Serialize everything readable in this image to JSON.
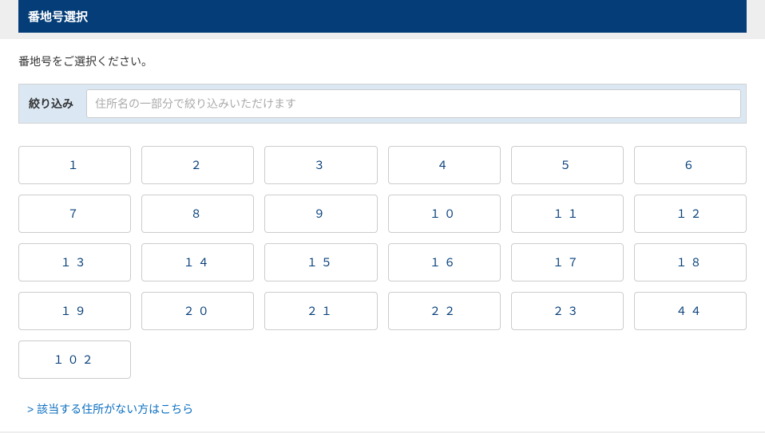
{
  "header": {
    "title": "番地号選択"
  },
  "instruction": "番地号をご選択ください。",
  "filter": {
    "label": "絞り込み",
    "placeholder": "住所名の一部分で絞り込みいただけます"
  },
  "options": [
    "１",
    "２",
    "３",
    "４",
    "５",
    "６",
    "７",
    "８",
    "９",
    "１０",
    "１１",
    "１２",
    "１３",
    "１４",
    "１５",
    "１６",
    "１７",
    "１８",
    "１９",
    "２０",
    "２１",
    "２２",
    "２３",
    "４４",
    "１０２"
  ],
  "footer": {
    "no_match_link": "> 該当する住所がない方はこちら"
  }
}
